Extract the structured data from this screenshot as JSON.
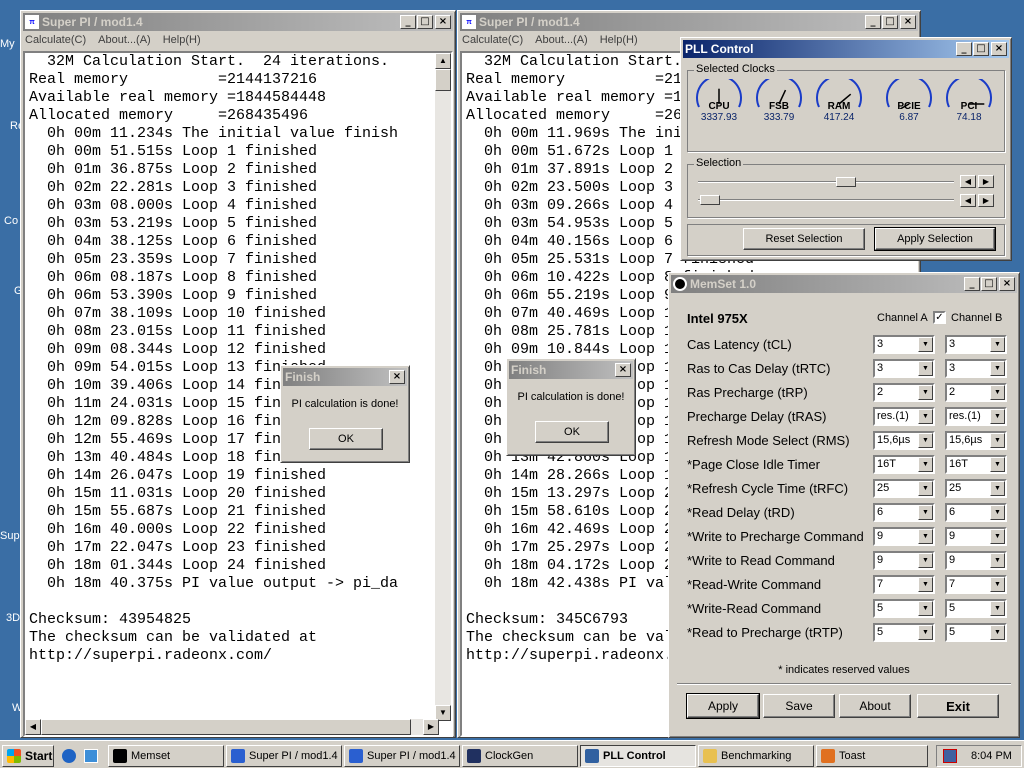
{
  "desktop": {
    "labels": [
      "My",
      "Re",
      "Co",
      "G",
      "Sup",
      "3D",
      "W"
    ]
  },
  "superpi1": {
    "title": "Super PI / mod1.4",
    "menu": [
      "Calculate(C)",
      "About...(A)",
      "Help(H)"
    ],
    "lines": [
      "  32M Calculation Start.  24 iterations.",
      "Real memory          =2144137216",
      "Available real memory =1844584448",
      "Allocated memory     =268435496",
      "  0h 00m 11.234s The initial value finish",
      "  0h 00m 51.515s Loop 1 finished",
      "  0h 01m 36.875s Loop 2 finished",
      "  0h 02m 22.281s Loop 3 finished",
      "  0h 03m 08.000s Loop 4 finished",
      "  0h 03m 53.219s Loop 5 finished",
      "  0h 04m 38.125s Loop 6 finished",
      "  0h 05m 23.359s Loop 7 finished",
      "  0h 06m 08.187s Loop 8 finished",
      "  0h 06m 53.390s Loop 9 finished",
      "  0h 07m 38.109s Loop 10 finished",
      "  0h 08m 23.015s Loop 11 finished",
      "  0h 09m 08.344s Loop 12 finished",
      "  0h 09m 54.015s Loop 13 finished",
      "  0h 10m 39.406s Loop 14 finished",
      "  0h 11m 24.031s Loop 15 finished",
      "  0h 12m 09.828s Loop 16 finished",
      "  0h 12m 55.469s Loop 17 finished",
      "  0h 13m 40.484s Loop 18 finished",
      "  0h 14m 26.047s Loop 19 finished",
      "  0h 15m 11.031s Loop 20 finished",
      "  0h 15m 55.687s Loop 21 finished",
      "  0h 16m 40.000s Loop 22 finished",
      "  0h 17m 22.047s Loop 23 finished",
      "  0h 18m 01.344s Loop 24 finished",
      "  0h 18m 40.375s PI value output -> pi_da",
      "",
      "Checksum: 43954825",
      "The checksum can be validated at",
      "http://superpi.radeonx.com/"
    ]
  },
  "superpi2": {
    "title": "Super PI / mod1.4",
    "menu": [
      "Calculate(C)",
      "About...(A)",
      "Help(H)"
    ],
    "lines": [
      "  32M Calculation Start.  24 iterations.",
      "Real memory          =2144137216",
      "Available real memory =1844584448",
      "Allocated memory     =268435496",
      "  0h 00m 11.969s The initial value finish",
      "  0h 00m 51.672s Loop 1 finished",
      "  0h 01m 37.891s Loop 2 finished",
      "  0h 02m 23.500s Loop 3 finished",
      "  0h 03m 09.266s Loop 4 finished",
      "  0h 03m 54.953s Loop 5 finished",
      "  0h 04m 40.156s Loop 6 finished",
      "  0h 05m 25.531s Loop 7 finished",
      "  0h 06m 10.422s Loop 8 finished",
      "  0h 06m 55.219s Loop 9 finished",
      "  0h 07m 40.469s Loop 10 finished",
      "  0h 08m 25.781s Loop 11 finished",
      "  0h 09m 10.844s Loop 12 finished",
      "  0h 09m 56.000s Loop 13 finished",
      "  0h 10m 41.000s Loop 14 finished",
      "  0h 11m 26.000s Loop 15 finished",
      "  0h 12m 11.000s Loop 16 finished",
      "  0h 12m 57.000s Loop 17 finished",
      "  0h 13m 42.860s Loop 18 finished",
      "  0h 14m 28.266s Loop 19 finished",
      "  0h 15m 13.297s Loop 20 finished",
      "  0h 15m 58.610s Loop 21 finished",
      "  0h 16m 42.469s Loop 22 finished",
      "  0h 17m 25.297s Loop 23 finished",
      "  0h 18m 04.172s Loop 24 finished",
      "  0h 18m 42.438s PI value output -> pi_da",
      "",
      "Checksum: 345C6793",
      "The checksum can be validated at",
      "http://superpi.radeonx.com/"
    ]
  },
  "dialog1": {
    "title": "Finish",
    "message": "PI calculation is done!",
    "ok": "OK"
  },
  "dialog2": {
    "title": "Finish",
    "message": "PI calculation is done!",
    "ok": "OK"
  },
  "pll": {
    "title": "PLL Control",
    "selected_clocks_label": "Selected Clocks",
    "gauges": [
      {
        "name": "CPU",
        "value": "3337.93"
      },
      {
        "name": "FSB",
        "value": "333.79"
      },
      {
        "name": "RAM",
        "value": "417.24"
      },
      {
        "name": "PCIE",
        "value": "6.87"
      },
      {
        "name": "PCI",
        "value": "74.18"
      }
    ],
    "selection_label": "Selection",
    "reset_button": "Reset Selection",
    "apply_button": "Apply Selection"
  },
  "memset": {
    "title": "MemSet 1.0",
    "chipset": "Intel 975X",
    "channel_a": "Channel A",
    "channel_b": "Channel B",
    "channel_b_checked": true,
    "rows": [
      {
        "label": "Cas Latency  (tCL)",
        "a": "3",
        "b": "3"
      },
      {
        "label": "Ras to Cas Delay  (tRTC)",
        "a": "3",
        "b": "3"
      },
      {
        "label": "Ras Precharge  (tRP)",
        "a": "2",
        "b": "2"
      },
      {
        "label": "Precharge Delay  (tRAS)",
        "a": "res.(1)",
        "b": "res.(1)"
      },
      {
        "label": "Refresh Mode Select  (RMS)",
        "a": "15,6µs",
        "b": "15,6µs"
      },
      {
        "label": "*Page Close Idle Timer",
        "a": "16T",
        "b": "16T"
      },
      {
        "label": "*Refresh Cycle Time (tRFC)",
        "a": "25",
        "b": "25"
      },
      {
        "label": "*Read Delay (tRD)",
        "a": "6",
        "b": "6"
      },
      {
        "label": "*Write to Precharge Command",
        "a": "9",
        "b": "9"
      },
      {
        "label": "*Write to Read Command",
        "a": "9",
        "b": "9"
      },
      {
        "label": "*Read-Write Command",
        "a": "7",
        "b": "7"
      },
      {
        "label": "*Write-Read Command",
        "a": "5",
        "b": "5"
      },
      {
        "label": "*Read to Precharge (tRTP)",
        "a": "5",
        "b": "5"
      }
    ],
    "note": "* indicates reserved values",
    "buttons": {
      "apply": "Apply",
      "save": "Save",
      "about": "About",
      "exit": "Exit"
    }
  },
  "taskbar": {
    "start": "Start",
    "items": [
      {
        "label": "Memset",
        "icon": "memset-icon"
      },
      {
        "label": "Super PI / mod1.4",
        "icon": "superpi-icon"
      },
      {
        "label": "Super PI / mod1.4",
        "icon": "superpi-icon"
      },
      {
        "label": "ClockGen",
        "icon": "clockgen-icon"
      },
      {
        "label": "PLL Control",
        "icon": "pll-icon",
        "active": true
      },
      {
        "label": "Benchmarking",
        "icon": "folder-icon"
      },
      {
        "label": "Toast",
        "icon": "toast-icon"
      }
    ],
    "clock": "8:04 PM"
  },
  "colors": {
    "desktop": "#3a6ea5",
    "titlebar_active": "#0a246a",
    "titlebar_inactive": "#808080",
    "face": "#d4d0c8"
  }
}
